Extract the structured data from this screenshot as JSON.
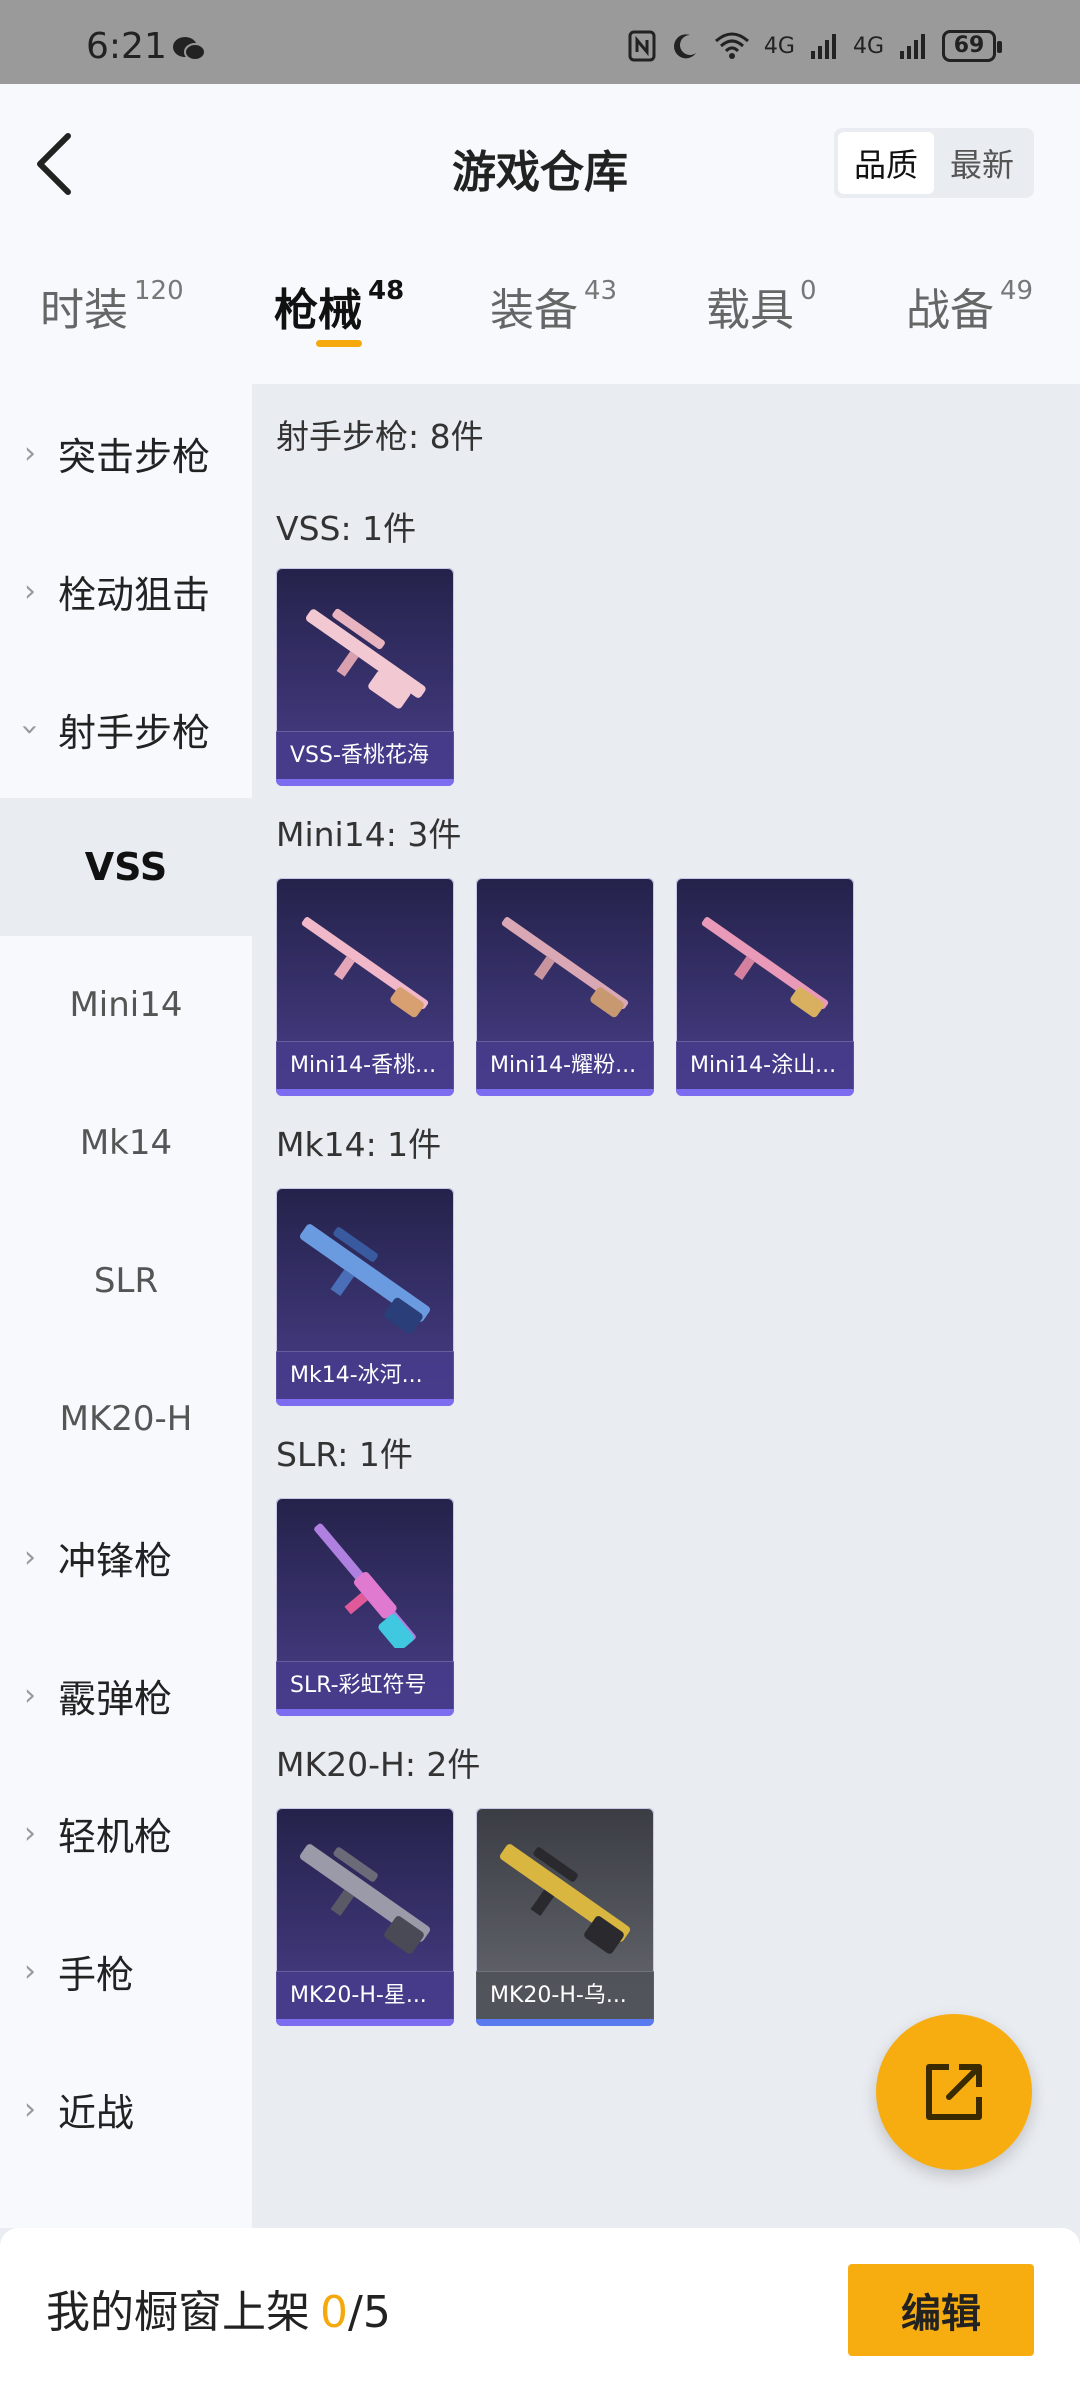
{
  "status_bar": {
    "time": "6:21",
    "battery": "69",
    "signal_a": "4G",
    "signal_b": "4G"
  },
  "header": {
    "title": "游戏仓库",
    "sort_options": [
      "品质",
      "最新"
    ],
    "sort_selected": "品质"
  },
  "tabs": [
    {
      "label": "时装",
      "count": "120"
    },
    {
      "label": "枪械",
      "count": "48"
    },
    {
      "label": "装备",
      "count": "43"
    },
    {
      "label": "载具",
      "count": "0"
    },
    {
      "label": "战备",
      "count": "49"
    }
  ],
  "active_tab": "枪械",
  "sidebar": {
    "items": [
      {
        "label": "突击步枪",
        "type": "category",
        "expanded": false
      },
      {
        "label": "栓动狙击",
        "type": "category",
        "expanded": false
      },
      {
        "label": "射手步枪",
        "type": "category",
        "expanded": true
      },
      {
        "label": "VSS",
        "type": "sub",
        "active": true
      },
      {
        "label": "Mini14",
        "type": "sub"
      },
      {
        "label": "Mk14",
        "type": "sub"
      },
      {
        "label": "SLR",
        "type": "sub"
      },
      {
        "label": "MK20-H",
        "type": "sub"
      },
      {
        "label": "冲锋枪",
        "type": "category",
        "expanded": false
      },
      {
        "label": "霰弹枪",
        "type": "category",
        "expanded": false
      },
      {
        "label": "轻机枪",
        "type": "category",
        "expanded": false
      },
      {
        "label": "手枪",
        "type": "category",
        "expanded": false
      },
      {
        "label": "近战",
        "type": "category",
        "expanded": false
      }
    ]
  },
  "content": {
    "category_title": "射手步枪: 8件",
    "groups": [
      {
        "title": "VSS: 1件",
        "items": [
          {
            "name": "VSS-香桃花海",
            "icon": "vss-pink-rifle-icon",
            "color": "#f2c8d2"
          }
        ]
      },
      {
        "title": "Mini14: 3件",
        "items": [
          {
            "name": "Mini14-香桃...",
            "icon": "mini14-pink-rifle-icon",
            "color": "#f0b8c8"
          },
          {
            "name": "Mini14-耀粉...",
            "icon": "mini14-rose-rifle-icon",
            "color": "#d9a8b4"
          },
          {
            "name": "Mini14-涂山...",
            "icon": "mini14-magenta-rifle-icon",
            "color": "#e89ab8"
          }
        ]
      },
      {
        "title": "Mk14: 1件",
        "items": [
          {
            "name": "Mk14-冰河...",
            "icon": "mk14-blue-rifle-icon",
            "color": "#6a9be0"
          }
        ]
      },
      {
        "title": "SLR: 1件",
        "items": [
          {
            "name": "SLR-彩虹符号",
            "icon": "slr-rainbow-rifle-icon",
            "color": "#e07ad0"
          }
        ]
      },
      {
        "title": "MK20-H: 2件",
        "items": [
          {
            "name": "MK20-H-星...",
            "icon": "mk20h-grey-rifle-icon",
            "color": "#9a9aa8",
            "quality": "purple"
          },
          {
            "name": "MK20-H-乌...",
            "icon": "mk20h-gold-rifle-icon",
            "color": "#d9b640",
            "quality": "grey"
          }
        ]
      }
    ]
  },
  "bottom_bar": {
    "label": "我的橱窗上架",
    "current": "0",
    "separator": "/",
    "max": "5",
    "edit_label": "编辑"
  },
  "colors": {
    "accent": "#f7ad0f",
    "card_purple": "#3a3370",
    "card_grey": "#56585f"
  }
}
